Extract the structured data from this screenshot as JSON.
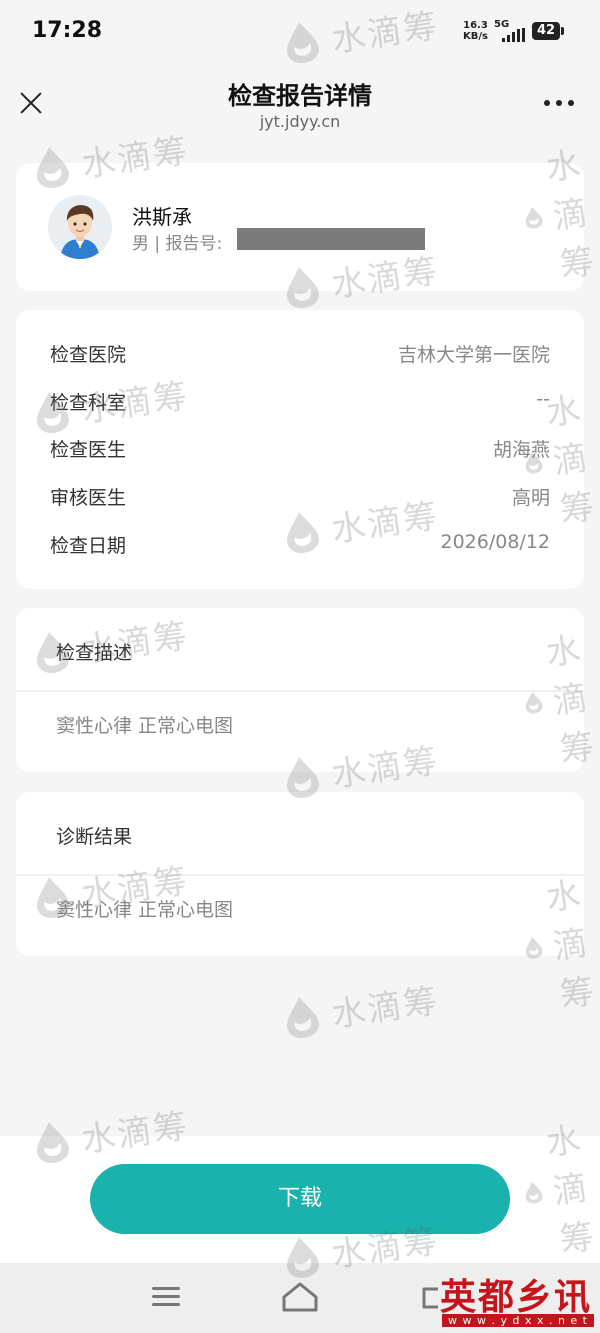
{
  "status_bar": {
    "time": "17:28",
    "net_speed_value": "16.3",
    "net_speed_unit": "KB/s",
    "network": "5G",
    "battery": "42"
  },
  "header": {
    "title": "检查报告详情",
    "url": "jyt.jdyy.cn",
    "close_icon": "close-icon",
    "more_icon": "more-icon"
  },
  "patient": {
    "name": "洪斯承",
    "meta": "男 | 报告号:"
  },
  "info": {
    "rows": [
      {
        "label": "检查医院",
        "value": "吉林大学第一医院"
      },
      {
        "label": "检查科室",
        "value": "--"
      },
      {
        "label": "检查医生",
        "value": "胡海燕"
      },
      {
        "label": "审核医生",
        "value": "高明"
      },
      {
        "label": "检查日期",
        "value": "2026/08/12"
      }
    ]
  },
  "description": {
    "title": "检查描述",
    "content": "窦性心律 正常心电图"
  },
  "diagnosis": {
    "title": "诊断结果",
    "content": "窦性心律 正常心电图"
  },
  "actions": {
    "download_label": "下载"
  },
  "watermark": {
    "text": "水滴筹"
  },
  "site_logo": {
    "text": "英都乡讯",
    "url": "w w w . y d x x . n e t"
  },
  "colors": {
    "accent": "#1ab2ad",
    "background": "#f5f5f5",
    "card": "#ffffff",
    "logo_red": "#c4151c"
  }
}
